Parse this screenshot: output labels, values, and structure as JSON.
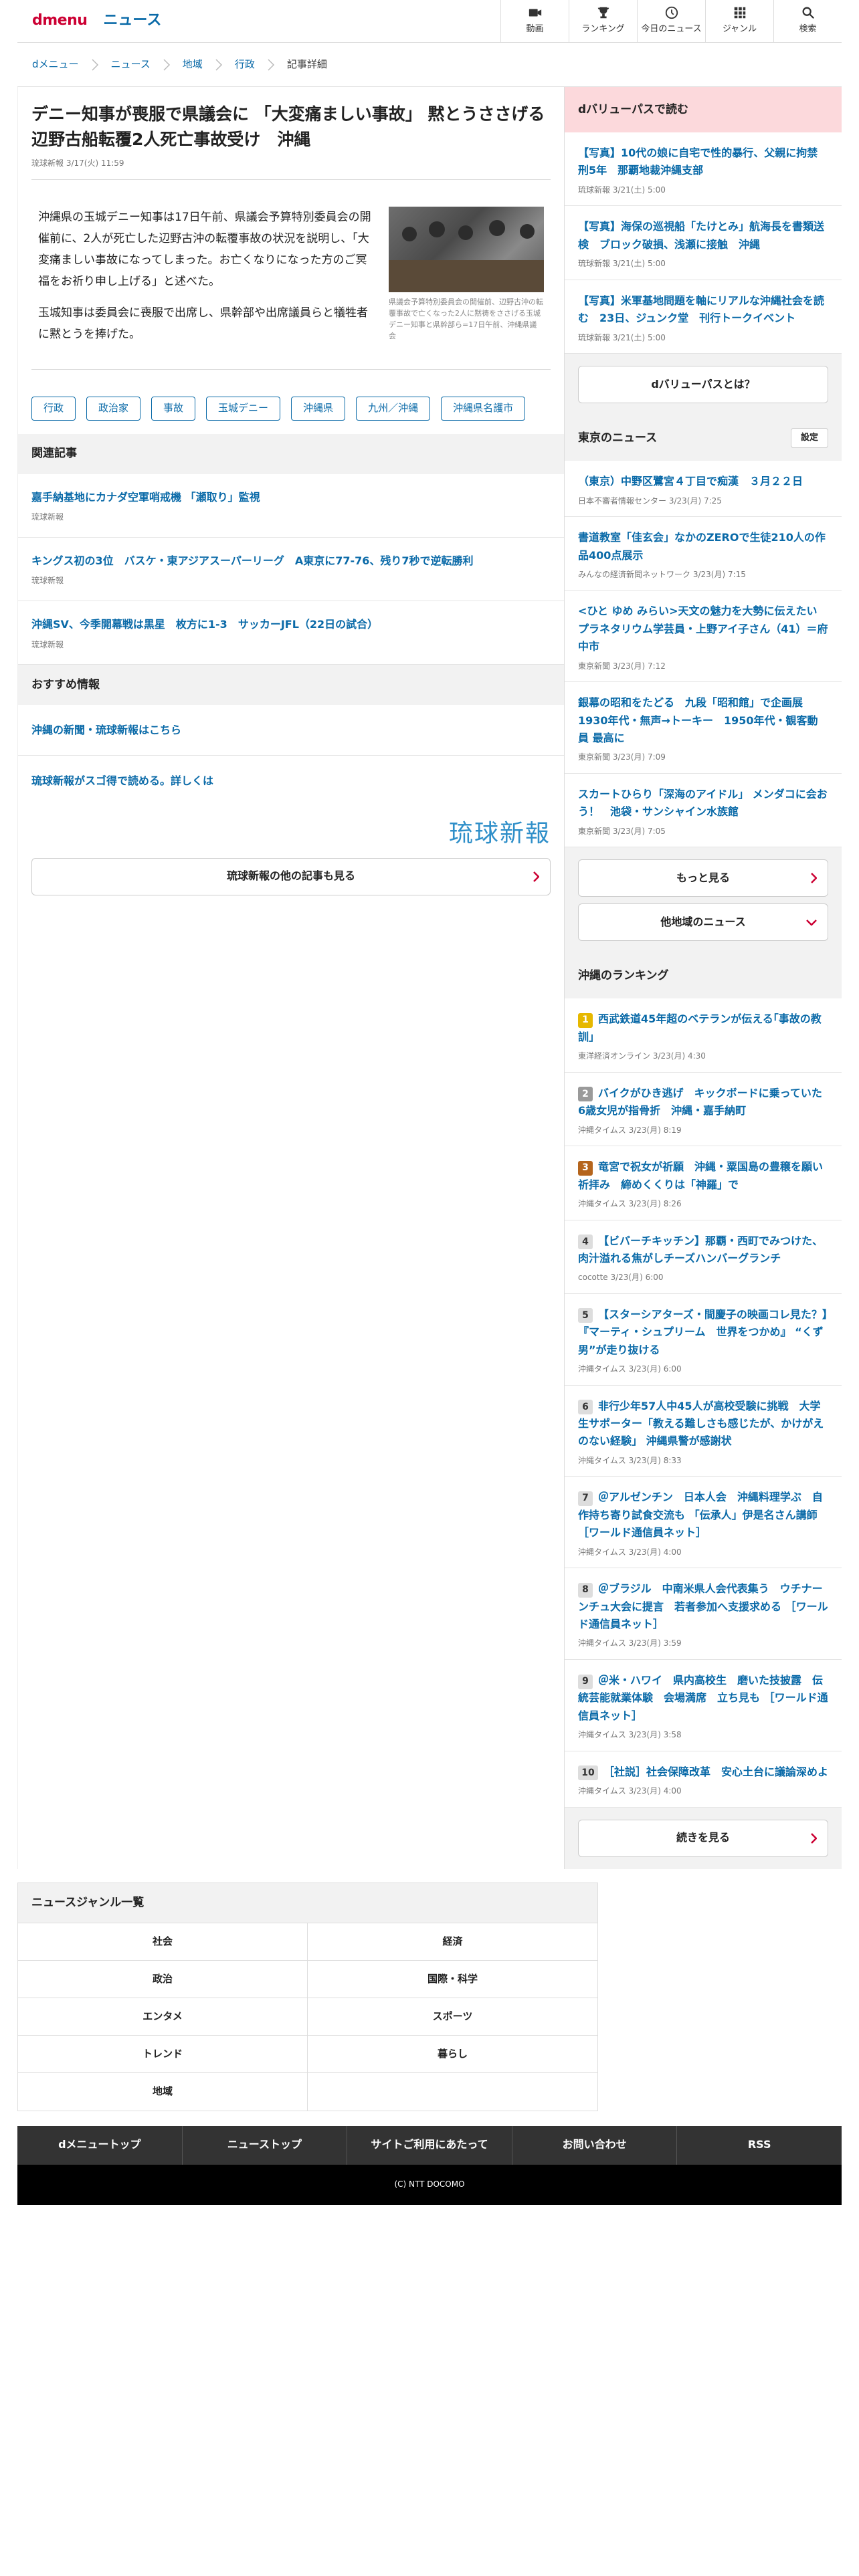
{
  "header": {
    "brand": "dmenu",
    "section": "ニュース",
    "nav": [
      {
        "label": "動画",
        "icon": "video-icon"
      },
      {
        "label": "ランキング",
        "icon": "trophy-icon"
      },
      {
        "label": "今日のニュース",
        "icon": "clock-icon"
      },
      {
        "label": "ジャンル",
        "icon": "grid-icon"
      },
      {
        "label": "検索",
        "icon": "search-icon"
      }
    ]
  },
  "breadcrumb": [
    "dメニュー",
    "ニュース",
    "地域",
    "行政",
    "記事詳細"
  ],
  "article": {
    "title": "デニー知事が喪服で県議会に 「大変痛ましい事故」 黙とうささげる　辺野古船転覆2人死亡事故受け　沖縄",
    "source": "琉球新報 3/17(火) 11:59",
    "paragraphs": [
      "沖縄県の玉城デニー知事は17日午前、県議会予算特別委員会の開催前に、2人が死亡した辺野古沖の転覆事故の状況を説明し、「大変痛ましい事故になってしまった。お亡くなりになった方のご冥福をお祈り申し上げる」と述べた。",
      "玉城知事は委員会に喪服で出席し、県幹部や出席議員らと犠牲者に黙とうを捧げた。"
    ],
    "photo_caption": "県議会予算特別委員会の開催前、辺野古沖の転覆事故で亡くなった2人に黙祷をささげる玉城デニー知事と県幹部ら=17日午前、沖縄県議会",
    "tags": [
      "行政",
      "政治家",
      "事故",
      "玉城デニー",
      "沖縄県",
      "九州／沖縄",
      "沖縄県名護市"
    ]
  },
  "related": {
    "heading": "関連記事",
    "items": [
      {
        "title": "嘉手納基地にカナダ空軍哨戒機 「瀬取り」監視",
        "source": "琉球新報"
      },
      {
        "title": "キングス初の3位　バスケ・東アジアスーパーリーグ　A東京に77-76、残り7秒で逆転勝利",
        "source": "琉球新報"
      },
      {
        "title": "沖縄SV、今季開幕戦は黒星　枚方に1-3　サッカーJFL（22日の試合）",
        "source": "琉球新報"
      }
    ]
  },
  "recommend": {
    "heading": "おすすめ情報",
    "items": [
      "沖縄の新聞・琉球新報はこちら",
      "琉球新報がスゴ得で読める。詳しくは"
    ]
  },
  "brand_logo": "琉球新報",
  "more_button": "琉球新報の他の記事も見る",
  "side": {
    "dvalue": {
      "heading": "dバリューパスで読む",
      "items": [
        {
          "title": "【写真】10代の娘に自宅で性的暴行、父親に拘禁刑5年　那覇地裁沖縄支部",
          "source": "琉球新報 3/21(土) 5:00"
        },
        {
          "title": "【写真】海保の巡視船「たけとみ」航海長を書類送検　ブロック破損、浅瀬に接触　沖縄",
          "source": "琉球新報 3/21(土) 5:00"
        },
        {
          "title": "【写真】米軍基地問題を軸にリアルな沖縄社会を読む　23日、ジュンク堂　刊行トークイベント",
          "source": "琉球新報 3/21(土) 5:00"
        }
      ],
      "button": "dバリューパスとは？"
    },
    "tokyo": {
      "heading": "東京のニュース",
      "setting": "設定",
      "items": [
        {
          "title": "（東京）中野区鷺宮４丁目で痴漢　３月２２日",
          "source": "日本不審者情報センター 3/23(月) 7:25"
        },
        {
          "title": "書道教室「佳玄会」なかのZEROで生徒210人の作品400点展示",
          "source": "みんなの経済新聞ネットワーク 3/23(月) 7:15"
        },
        {
          "title": "<ひと ゆめ みらい>天文の魅力を大勢に伝えたい　プラネタリウム学芸員・上野アイ子さん（41）＝府中市",
          "source": "東京新聞 3/23(月) 7:12"
        },
        {
          "title": "銀幕の昭和をたどる　九段「昭和館」で企画展　1930年代・無声→トーキー　1950年代・観客動員 最高に",
          "source": "東京新聞 3/23(月) 7:09"
        },
        {
          "title": "スカートひらり「深海のアイドル」 メンダコに会おう！　池袋・サンシャイン水族館",
          "source": "東京新聞 3/23(月) 7:05"
        }
      ],
      "more": "もっと見る",
      "other": "他地域のニュース"
    },
    "ranking": {
      "heading": "沖縄のランキング",
      "items": [
        {
          "rank": "1",
          "title": "西武鉄道45年超のベテランが伝える｢事故の教訓｣",
          "source": "東洋経済オンライン 3/23(月) 4:30"
        },
        {
          "rank": "2",
          "title": "バイクがひき逃げ　キックボードに乗っていた6歳女児が指骨折　沖縄・嘉手納町",
          "source": "沖縄タイムス 3/23(月) 8:19"
        },
        {
          "rank": "3",
          "title": "竜宮で祝女が祈願　沖縄・粟国島の豊穣を願い祈拝み　締めくくりは「神羅」で",
          "source": "沖縄タイムス 3/23(月) 8:26"
        },
        {
          "rank": "4",
          "title": "【ビバーチキッチン】那覇・西町でみつけた、肉汁溢れる焦がしチーズハンバーグランチ",
          "source": "cocotte 3/23(月) 6:00"
        },
        {
          "rank": "5",
          "title": "【スターシアターズ・間慶子の映画コレ見た？】『マーティ・シュプリーム　世界をつかめ』 “くず男”が走り抜ける",
          "source": "沖縄タイムス 3/23(月) 6:00"
        },
        {
          "rank": "6",
          "title": "非行少年57人中45人が高校受験に挑戦　大学生サポーター「教える難しさも感じたが、かけがえのない経験」 沖縄県警が感謝状",
          "source": "沖縄タイムス 3/23(月) 8:33"
        },
        {
          "rank": "7",
          "title": "＠アルゼンチン　日本人会　沖縄料理学ぶ　自作持ち寄り試食交流も 「伝承人」伊是名さん講師 ［ワールド通信員ネット］",
          "source": "沖縄タイムス 3/23(月) 4:00"
        },
        {
          "rank": "8",
          "title": "＠ブラジル　中南米県人会代表集う　ウチナーンチュ大会に提言　若者参加へ支援求める ［ワールド通信員ネット］",
          "source": "沖縄タイムス 3/23(月) 3:59"
        },
        {
          "rank": "9",
          "title": "＠米・ハワイ　県内高校生　磨いた技披露　伝統芸能就業体験　会場満席　立ち見も ［ワールド通信員ネット］",
          "source": "沖縄タイムス 3/23(月) 3:58"
        },
        {
          "rank": "10",
          "title": "［社説］社会保障改革　安心土台に議論深めよ",
          "source": "沖縄タイムス 3/23(月) 4:00"
        }
      ],
      "button": "続きを見る"
    }
  },
  "genre": {
    "heading": "ニュースジャンル一覧",
    "items": [
      "社会",
      "経済",
      "政治",
      "国際・科学",
      "エンタメ",
      "スポーツ",
      "トレンド",
      "暮らし",
      "地域",
      ""
    ]
  },
  "footer": {
    "links": [
      "dメニュートップ",
      "ニューストップ",
      "サイトご利用にあたって",
      "お問い合わせ",
      "RSS"
    ],
    "copyright": "(C) NTT DOCOMO"
  },
  "colors": {
    "link": "#0a6aa8",
    "brand_red": "#cc0033",
    "pink": "#fcd9dc"
  }
}
